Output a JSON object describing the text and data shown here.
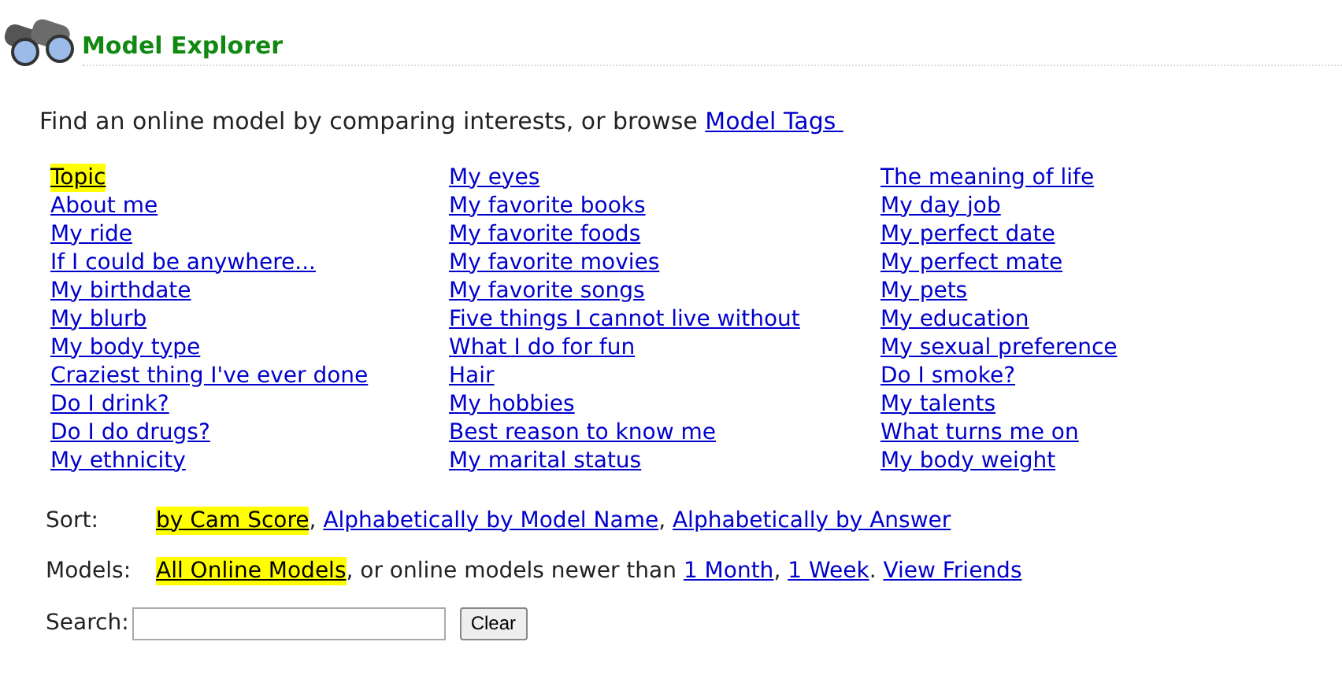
{
  "header": {
    "title": "Model Explorer"
  },
  "intro": {
    "text": "Find an online model by comparing interests, or browse ",
    "link": "Model Tags "
  },
  "topic_columns": [
    [
      {
        "label": "Topic",
        "selected": true
      },
      {
        "label": "About me",
        "selected": false
      },
      {
        "label": "My ride",
        "selected": false
      },
      {
        "label": "If I could be anywhere...",
        "selected": false
      },
      {
        "label": "My birthdate",
        "selected": false
      },
      {
        "label": "My blurb",
        "selected": false
      },
      {
        "label": "My body type",
        "selected": false
      },
      {
        "label": "Craziest thing I've ever done",
        "selected": false
      },
      {
        "label": "Do I drink?",
        "selected": false
      },
      {
        "label": "Do I do drugs?",
        "selected": false
      },
      {
        "label": "My ethnicity",
        "selected": false
      }
    ],
    [
      {
        "label": "My eyes",
        "selected": false
      },
      {
        "label": "My favorite books",
        "selected": false
      },
      {
        "label": "My favorite foods",
        "selected": false
      },
      {
        "label": "My favorite movies",
        "selected": false
      },
      {
        "label": "My favorite songs",
        "selected": false
      },
      {
        "label": "Five things I cannot live without",
        "selected": false
      },
      {
        "label": "What I do for fun",
        "selected": false
      },
      {
        "label": "Hair",
        "selected": false
      },
      {
        "label": "My hobbies",
        "selected": false
      },
      {
        "label": "Best reason to know me",
        "selected": false
      },
      {
        "label": "My marital status",
        "selected": false
      }
    ],
    [
      {
        "label": "The meaning of life",
        "selected": false
      },
      {
        "label": "My day job",
        "selected": false
      },
      {
        "label": "My perfect date",
        "selected": false
      },
      {
        "label": "My perfect mate",
        "selected": false
      },
      {
        "label": "My pets",
        "selected": false
      },
      {
        "label": "My education",
        "selected": false
      },
      {
        "label": "My sexual preference",
        "selected": false
      },
      {
        "label": "Do I smoke?",
        "selected": false
      },
      {
        "label": "My talents",
        "selected": false
      },
      {
        "label": "What turns me on",
        "selected": false
      },
      {
        "label": "My body weight",
        "selected": false
      }
    ]
  ],
  "sort": {
    "label": "Sort:",
    "options": [
      {
        "label": "by Cam Score",
        "selected": true,
        "after": ", "
      },
      {
        "label": "Alphabetically by Model Name",
        "selected": false,
        "after": ", "
      },
      {
        "label": "Alphabetically by Answer",
        "selected": false
      }
    ]
  },
  "models": {
    "label": "Models:",
    "options": [
      {
        "label": "All Online Models",
        "selected": true,
        "after": ", or online models newer than "
      },
      {
        "label": "1 Month",
        "selected": false,
        "after": ", "
      },
      {
        "label": "1 Week",
        "selected": false,
        "after": ". "
      },
      {
        "label": "View Friends",
        "selected": false
      }
    ]
  },
  "search": {
    "label": "Search:",
    "button": "Clear"
  }
}
